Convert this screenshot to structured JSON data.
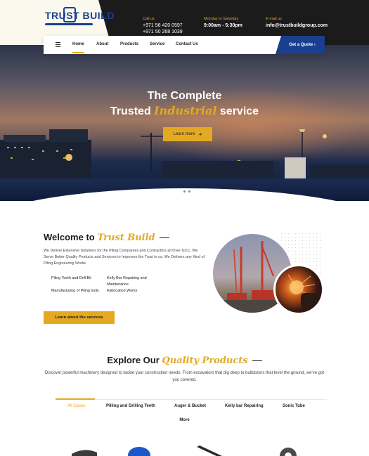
{
  "brand": {
    "logo_text": "TRUST BUILD",
    "colors": {
      "accent": "#e3a923",
      "primary": "#1a3f8f",
      "dark": "#1b1b1b"
    }
  },
  "topbar": {
    "phone": {
      "label": "Call us",
      "numbers": [
        "+971 56 420 0597",
        "+971 50 268 1039"
      ]
    },
    "hours": {
      "label": "Monday to Saturday",
      "value": "9:00am - 5:30pm"
    },
    "email": {
      "label": "E-mail us",
      "value": "info@trustbuildgroup.com"
    }
  },
  "nav": {
    "menu_icon": "hamburger-icon",
    "items": [
      "Home",
      "About",
      "Products",
      "Service",
      "Contact Us"
    ],
    "active": "Home",
    "quote_button": "Get a Quote ›"
  },
  "hero": {
    "title_line1": "The Complete",
    "title_line2_pre": "Trusted ",
    "title_line2_accent": "Industrial",
    "title_line2_post": " service",
    "button_label": "Learn more",
    "button_icon": "arrow-right-icon",
    "slides": 3,
    "active_slide": 1
  },
  "welcome": {
    "title_pre": "Welcome to ",
    "title_accent": "Trust Build",
    "description": "We Deliver Extensive Solutions for the Piling Companies and Contractors all Over GCC. We Serve Better Quality Products and Services to Improves the Trust in us. We Delivers any Kind of Piling Engineering Works",
    "features": [
      "Piling Teeth and Drill Bit",
      "Manufacturing of Piling tools",
      "Kelly Bar Repairing and Maintenance",
      "Fabrication Works"
    ],
    "button_label": "Learn about the services"
  },
  "explore": {
    "title_pre": "Explore Our ",
    "title_accent": "Quality Products",
    "description": "Discover powerful machinery designed to tackle your construction needs. From excavators that dig deep to bulldozers that level the ground, we've got you covered.",
    "tabs": [
      "All Cases",
      "Pilling and Drilling Teeth",
      "Auger & Bucket",
      "Kelly bar Repairing",
      "Sonic Tube"
    ],
    "active_tab": "All Cases",
    "more_label": "More"
  }
}
